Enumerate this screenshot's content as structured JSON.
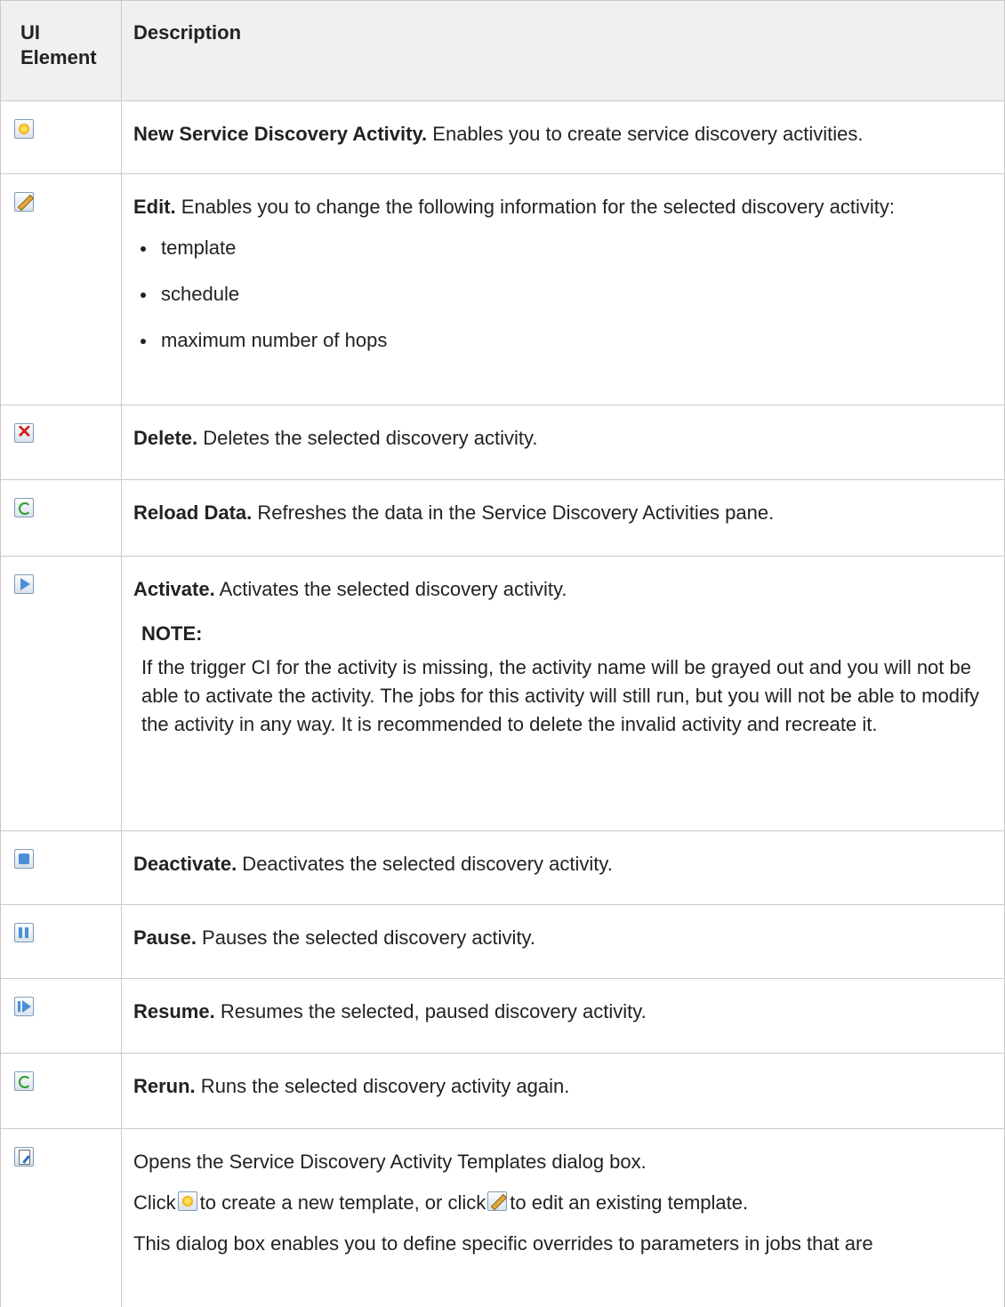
{
  "table": {
    "header": {
      "col1": "UI Element",
      "col2": "Description"
    },
    "rows": [
      {
        "icon": "new-star-icon",
        "bold": "New Service Discovery Activity.",
        "text": " Enables you to create service discovery activities."
      },
      {
        "icon": "edit-pencil-icon",
        "bold": "Edit.",
        "text": " Enables you to change the following information for the selected discovery activity:",
        "bullets": [
          "template",
          "schedule",
          "maximum number of hops"
        ]
      },
      {
        "icon": "delete-x-icon",
        "bold": "Delete.",
        "text": " Deletes the selected discovery activity."
      },
      {
        "icon": "reload-icon",
        "bold": "Reload Data.",
        "text": " Refreshes the data in the Service Discovery Activities pane."
      },
      {
        "icon": "activate-play-icon",
        "bold": "Activate.",
        "text": " Activates the selected discovery activity.",
        "note_label": "NOTE:",
        "note_text": "If the trigger CI for the activity is missing, the activity name will be grayed out and you will not be able to activate the activity. The jobs for this activity will still run, but you will not be able to modify the activity in any way. It is recommended to delete the invalid activity and recreate it."
      },
      {
        "icon": "deactivate-stop-icon",
        "bold": "Deactivate.",
        "text": " Deactivates the selected discovery activity."
      },
      {
        "icon": "pause-icon",
        "bold": "Pause.",
        "text": " Pauses the selected discovery activity."
      },
      {
        "icon": "resume-icon",
        "bold": "Resume.",
        "text": " Resumes the selected, paused discovery activity."
      },
      {
        "icon": "rerun-icon",
        "bold": "Rerun.",
        "text": " Runs the selected discovery activity again."
      },
      {
        "icon": "templates-icon",
        "line1": "Opens the Service Discovery Activity Templates dialog box.",
        "line2_a": "Click",
        "line2_b": "to create a new template, or click",
        "line2_c": "to edit an existing template.",
        "line3": "This dialog box enables you to define specific overrides to parameters in jobs that are"
      }
    ]
  }
}
